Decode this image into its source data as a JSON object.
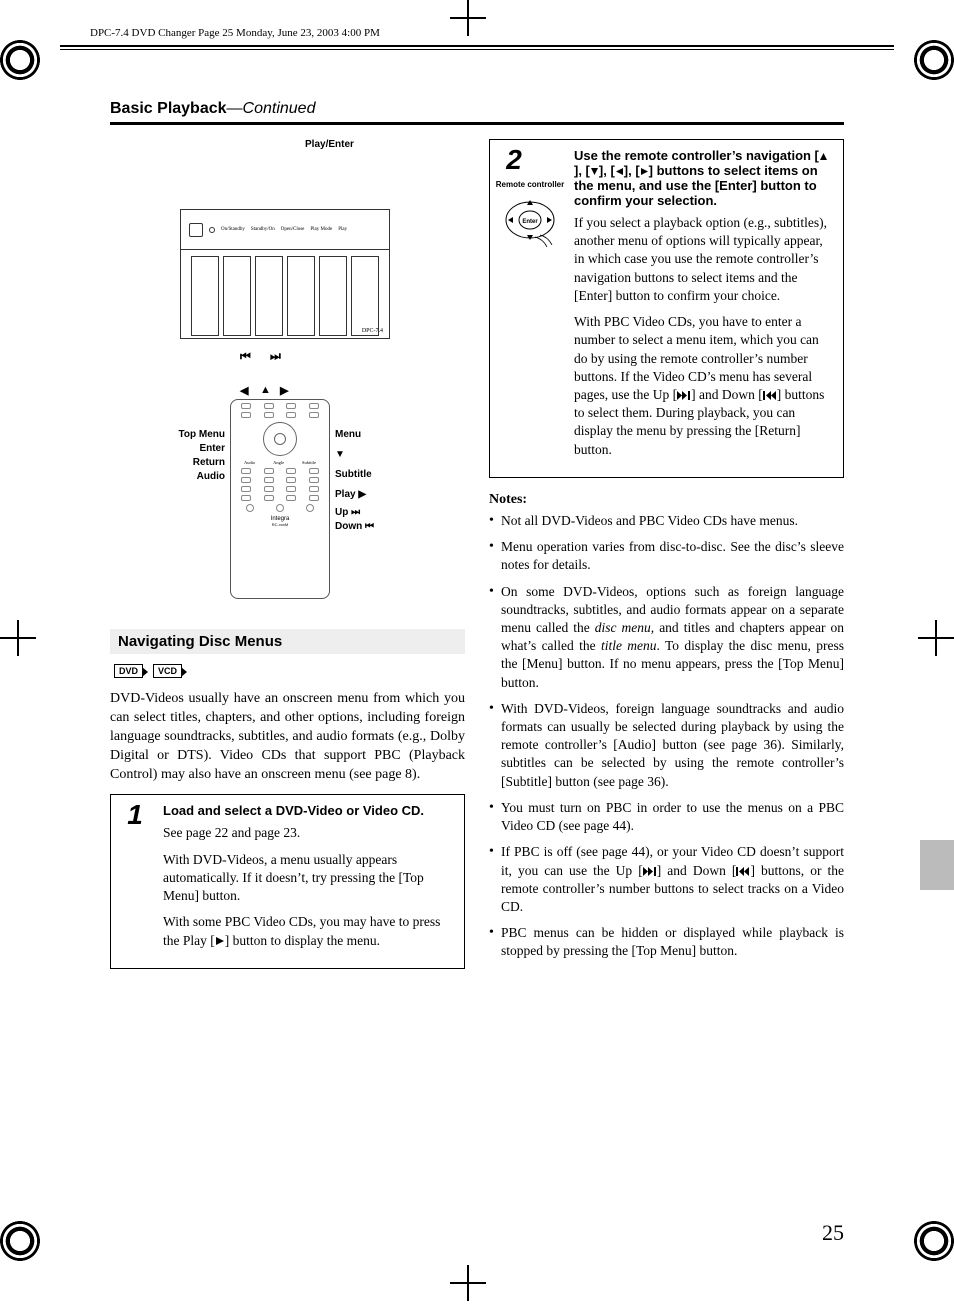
{
  "meta": {
    "header_line": "DPC-7.4 DVD Changer  Page 25  Monday, June 23, 2003  4:00 PM"
  },
  "page": {
    "section_title": "Basic Playback",
    "section_cont": "—Continued",
    "page_number": "25"
  },
  "diagram": {
    "play_enter": "Play/Enter",
    "model": "DPC-7.4",
    "front_btns": [
      "On/Standby",
      "Standby/On",
      "Open/Close",
      "Play Mode",
      "Play"
    ],
    "skip_prev": "⏮",
    "skip_next": "⏭",
    "nav_left": "◀",
    "nav_up": "▲",
    "nav_right": "▶",
    "labels_left": [
      "Top Menu",
      "Enter",
      "Return",
      "Audio"
    ],
    "labels_right": [
      "Menu",
      "▼",
      "Subtitle",
      "Play ▶",
      "Up ⏭",
      "Down ⏮"
    ],
    "remote_rows": [
      "Audio",
      "Angle",
      "Subtitle"
    ],
    "remote_brand": "Integra",
    "remote_model": "RC-xxxM"
  },
  "nav": {
    "heading": "Navigating Disc Menus",
    "badge_dvd": "DVD",
    "badge_vcd": "VCD",
    "intro": "DVD-Videos usually have an onscreen menu from which you can select titles, chapters, and other options, including foreign language soundtracks, subtitles, and audio formats (e.g., Dolby Digital or DTS). Video CDs that support PBC (Playback Control) may also have an onscreen menu (see page 8)."
  },
  "step1": {
    "num": "1",
    "lead": "Load and select a DVD-Video or Video CD.",
    "p1": "See page 22 and page 23.",
    "p2": "With DVD-Videos, a menu usually appears automatically. If it doesn’t, try pressing the [Top Menu] button.",
    "p3_a": "With some PBC Video CDs, you may have to press the Play [",
    "p3_b": "] button to display the menu."
  },
  "step2": {
    "num": "2",
    "rc_label": "Remote controller",
    "enter_label": "Enter",
    "lead_a": "Use the remote controller’s navigation [",
    "lead_b": "], [",
    "lead_c": "], [",
    "lead_d": "], [",
    "lead_e": "] buttons to select items on the menu, and use the [Enter] button to confirm your selection.",
    "p1": "If you select a playback option (e.g., subtitles), another menu of options will typically appear, in which case you use the remote controller’s navigation buttons to select items and the [Enter] button to confirm your choice.",
    "p2_a": "With PBC Video CDs, you have to enter a number to select a menu item, which you can do by using the remote controller’s number buttons. If the Video CD’s menu has several pages, use the Up [",
    "p2_b": "] and Down [",
    "p2_c": "] buttons to select them. During playback, you can display the menu by pressing the [Return] button."
  },
  "notes": {
    "head": "Notes:",
    "items": {
      "n1": "Not all DVD-Videos and PBC Video CDs have menus.",
      "n2": "Menu operation varies from disc-to-disc. See the disc’s sleeve notes for details.",
      "n3_a": "On some DVD-Videos, options such as foreign language soundtracks, subtitles, and audio formats appear on a separate menu called the ",
      "n3_i1": "disc menu,",
      "n3_b": " and titles and chapters appear on what’s called the ",
      "n3_i2": "title menu",
      "n3_c": ". To display the disc menu, press the [Menu] button. If no menu appears, press the [Top Menu] button.",
      "n4": "With DVD-Videos, foreign language soundtracks and audio formats can usually be selected during playback by using the remote controller’s [Audio] button (see page 36). Similarly, subtitles can be selected by using the remote controller’s [Subtitle] button (see page 36).",
      "n5": "You must turn on PBC in order to use the menus on a PBC Video CD (see page 44).",
      "n6_a": "If PBC is off (see page 44), or your Video CD doesn’t support it, you can use the Up [",
      "n6_b": "] and Down [",
      "n6_c": "] buttons, or the remote controller’s number buttons to select tracks on a Video CD.",
      "n7": "PBC menus can be hidden or displayed while playback is stopped by pressing the [Top Menu] button."
    }
  }
}
